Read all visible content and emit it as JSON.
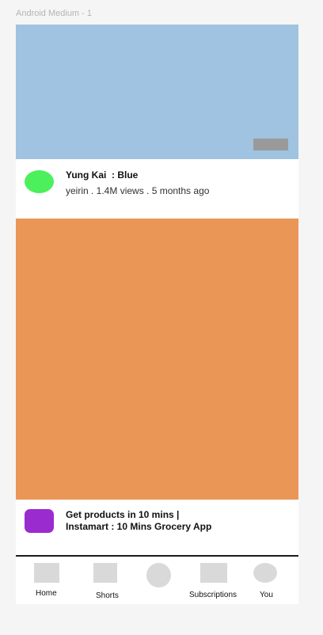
{
  "frame": {
    "title": "Android Medium - 1"
  },
  "feed": {
    "video": {
      "title": "Yung Kai  : Blue",
      "meta": "yeirin . 1.4M views . 5 months ago"
    },
    "ad": {
      "title_line1": "Get products in 10 mins |",
      "title_line2": "Instamart : 10 Mins Grocery App"
    }
  },
  "nav": {
    "items": [
      {
        "label": "Home"
      },
      {
        "label": "Shorts"
      },
      {
        "label": ""
      },
      {
        "label": "Subscriptions"
      },
      {
        "label": "You"
      }
    ]
  },
  "colors": {
    "page_background": "#f5f5f5",
    "video_thumbnail": "#9fc3e0",
    "duration_badge": "#9a9a9a",
    "channel_avatar": "#4bf05b",
    "ad_thumbnail": "#e99657",
    "ad_avatar": "#9a2bcf",
    "nav_icon_placeholder": "#d9d9d9"
  }
}
